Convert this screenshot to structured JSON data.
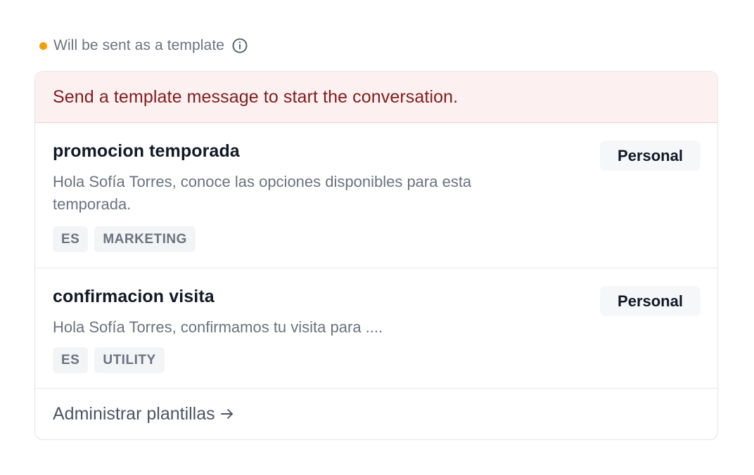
{
  "status": {
    "label": "Will be sent as a template",
    "dot_color": "#f59e0b",
    "icon": "info-icon"
  },
  "banner": {
    "text": "Send a template message to start the conversation.",
    "background": "#fdf0f0",
    "text_color": "#7f1d1d"
  },
  "templates": [
    {
      "name": "promocion temporada",
      "description": "Hola Sofía Torres, conoce las opciones disponibles para esta temporada.",
      "badge": "Personal",
      "tags": [
        "ES",
        "MARKETING"
      ]
    },
    {
      "name": "confirmacion visita",
      "description": "Hola Sofía Torres, confirmamos tu visita para ....",
      "badge": "Personal",
      "tags": [
        "ES",
        "UTILITY"
      ]
    }
  ],
  "footer": {
    "manage_label": "Administrar plantillas",
    "icon": "arrow-right-icon"
  }
}
